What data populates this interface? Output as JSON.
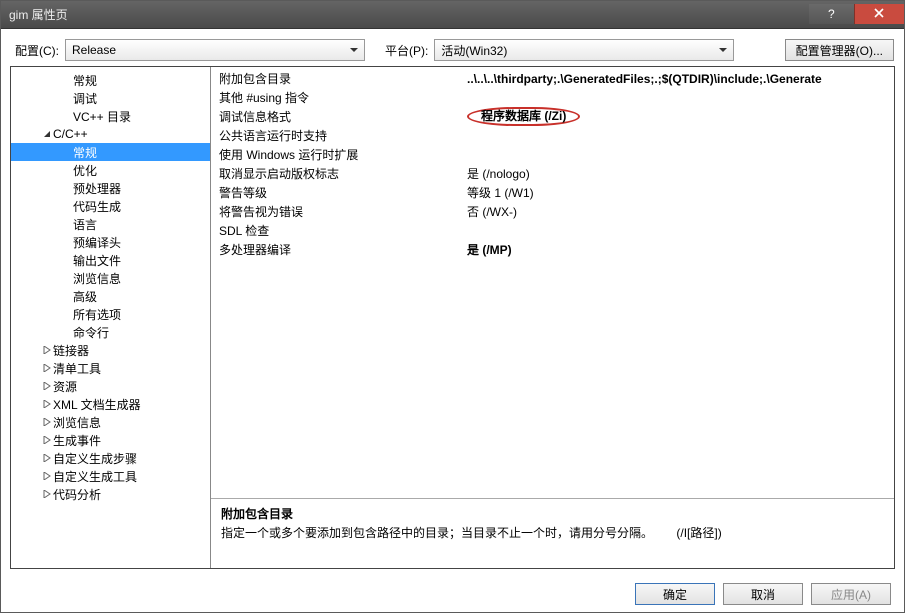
{
  "title": "gim 属性页",
  "toolbar": {
    "config_label": "配置(C):",
    "config_value": "Release",
    "platform_label": "平台(P):",
    "platform_value": "活动(Win32)",
    "manager_label": "配置管理器(O)..."
  },
  "tree": [
    {
      "label": "常规",
      "level": 2,
      "exp": "",
      "sel": false
    },
    {
      "label": "调试",
      "level": 2,
      "exp": "",
      "sel": false
    },
    {
      "label": "VC++ 目录",
      "level": 2,
      "exp": "",
      "sel": false
    },
    {
      "label": "C/C++",
      "level": 1,
      "exp": "open",
      "sel": false
    },
    {
      "label": "常规",
      "level": 2,
      "exp": "",
      "sel": true
    },
    {
      "label": "优化",
      "level": 2,
      "exp": "",
      "sel": false
    },
    {
      "label": "预处理器",
      "level": 2,
      "exp": "",
      "sel": false
    },
    {
      "label": "代码生成",
      "level": 2,
      "exp": "",
      "sel": false
    },
    {
      "label": "语言",
      "level": 2,
      "exp": "",
      "sel": false
    },
    {
      "label": "预编译头",
      "level": 2,
      "exp": "",
      "sel": false
    },
    {
      "label": "输出文件",
      "level": 2,
      "exp": "",
      "sel": false
    },
    {
      "label": "浏览信息",
      "level": 2,
      "exp": "",
      "sel": false
    },
    {
      "label": "高级",
      "level": 2,
      "exp": "",
      "sel": false
    },
    {
      "label": "所有选项",
      "level": 2,
      "exp": "",
      "sel": false
    },
    {
      "label": "命令行",
      "level": 2,
      "exp": "",
      "sel": false
    },
    {
      "label": "链接器",
      "level": 1,
      "exp": "closed",
      "sel": false
    },
    {
      "label": "清单工具",
      "level": 1,
      "exp": "closed",
      "sel": false
    },
    {
      "label": "资源",
      "level": 1,
      "exp": "closed",
      "sel": false
    },
    {
      "label": "XML 文档生成器",
      "level": 1,
      "exp": "closed",
      "sel": false
    },
    {
      "label": "浏览信息",
      "level": 1,
      "exp": "closed",
      "sel": false
    },
    {
      "label": "生成事件",
      "level": 1,
      "exp": "closed",
      "sel": false
    },
    {
      "label": "自定义生成步骤",
      "level": 1,
      "exp": "closed",
      "sel": false
    },
    {
      "label": "自定义生成工具",
      "level": 1,
      "exp": "closed",
      "sel": false
    },
    {
      "label": "代码分析",
      "level": 1,
      "exp": "closed",
      "sel": false
    }
  ],
  "props": [
    {
      "name": "附加包含目录",
      "value": "..\\..\\..\\thirdparty;.\\GeneratedFiles;.;$(QTDIR)\\include;.\\Generate",
      "bold": true,
      "hl": false
    },
    {
      "name": "其他 #using 指令",
      "value": "",
      "bold": false,
      "hl": false
    },
    {
      "name": "调试信息格式",
      "value": "程序数据库 (/Zi)",
      "bold": true,
      "hl": true
    },
    {
      "name": "公共语言运行时支持",
      "value": "",
      "bold": false,
      "hl": false
    },
    {
      "name": "使用 Windows 运行时扩展",
      "value": "",
      "bold": false,
      "hl": false
    },
    {
      "name": "取消显示启动版权标志",
      "value": "是 (/nologo)",
      "bold": false,
      "hl": false
    },
    {
      "name": "警告等级",
      "value": "等级 1 (/W1)",
      "bold": false,
      "hl": false
    },
    {
      "name": "将警告视为错误",
      "value": "否 (/WX-)",
      "bold": false,
      "hl": false
    },
    {
      "name": "SDL 检查",
      "value": "",
      "bold": false,
      "hl": false
    },
    {
      "name": "多处理器编译",
      "value": "是 (/MP)",
      "bold": true,
      "hl": false
    }
  ],
  "desc": {
    "title": "附加包含目录",
    "body": "指定一个或多个要添加到包含路径中的目录；当目录不止一个时，请用分号分隔。",
    "hint": "(/I[路径])"
  },
  "footer": {
    "ok": "确定",
    "cancel": "取消",
    "apply": "应用(A)"
  },
  "watermark": ""
}
